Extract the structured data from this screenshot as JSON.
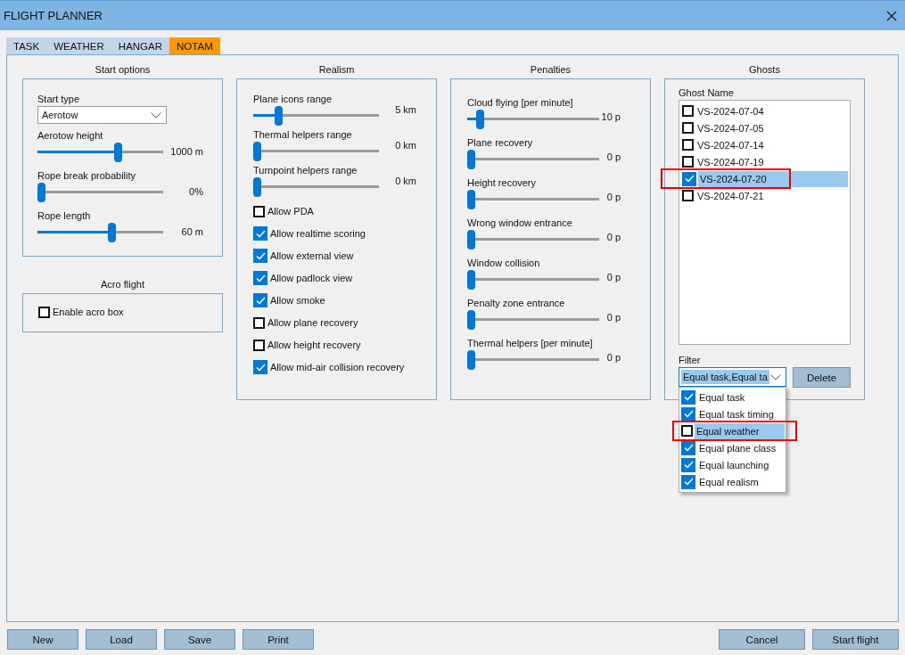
{
  "window": {
    "title": "FLIGHT PLANNER"
  },
  "tabs": [
    {
      "label": "TASK",
      "selected": false
    },
    {
      "label": "WEATHER",
      "selected": false
    },
    {
      "label": "HANGAR",
      "selected": false
    },
    {
      "label": "NOTAM",
      "selected": true
    }
  ],
  "start_options": {
    "title": "Start options",
    "start_type": {
      "label": "Start type",
      "value": "Aerotow"
    },
    "sliders": [
      {
        "label": "Aerotow height",
        "level": 0.65,
        "reading": "1000 m"
      },
      {
        "label": "Rope break probability",
        "level": 0,
        "reading": "0%"
      },
      {
        "label": "Rope length",
        "level": 0.6,
        "reading": "60 m"
      }
    ]
  },
  "acro_flight": {
    "title": "Acro flight",
    "checkbox": {
      "label": "Enable acro box",
      "checked": false
    }
  },
  "realism": {
    "title": "Realism",
    "sliders": [
      {
        "label": "Plane icons range",
        "level": 0.18,
        "reading": "5 km"
      },
      {
        "label": "Thermal helpers range",
        "level": 0,
        "reading": "0 km"
      },
      {
        "label": "Turnpoint helpers range",
        "level": 0,
        "reading": "0 km"
      }
    ],
    "checkboxes": [
      {
        "label": "Allow PDA",
        "checked": false
      },
      {
        "label": "Allow realtime scoring",
        "checked": true
      },
      {
        "label": "Allow external view",
        "checked": true
      },
      {
        "label": "Allow padlock view",
        "checked": true
      },
      {
        "label": "Allow smoke",
        "checked": true
      },
      {
        "label": "Allow plane recovery",
        "checked": false
      },
      {
        "label": "Allow height recovery",
        "checked": false
      },
      {
        "label": "Allow mid-air collision recovery",
        "checked": true
      }
    ]
  },
  "penalties": {
    "title": "Penalties",
    "sliders": [
      {
        "label": "Cloud flying [per minute]",
        "level": 0.07,
        "reading": "10 p"
      },
      {
        "label": "Plane recovery",
        "level": 0,
        "reading": "0 p"
      },
      {
        "label": "Height recovery",
        "level": 0,
        "reading": "0 p"
      },
      {
        "label": "Wrong window entrance",
        "level": 0,
        "reading": "0 p"
      },
      {
        "label": "Window collision",
        "level": 0,
        "reading": "0 p"
      },
      {
        "label": "Penalty zone entrance",
        "level": 0,
        "reading": "0 p"
      },
      {
        "label": "Thermal helpers [per minute]",
        "level": 0,
        "reading": "0 p"
      }
    ]
  },
  "ghosts": {
    "title": "Ghosts",
    "list_header": "Ghost Name",
    "items": [
      {
        "name": "VS-2024-07-04",
        "checked": false,
        "selected": false,
        "highlighted": false
      },
      {
        "name": "VS-2024-07-05",
        "checked": false,
        "selected": false,
        "highlighted": false
      },
      {
        "name": "VS-2024-07-14",
        "checked": false,
        "selected": false,
        "highlighted": false
      },
      {
        "name": "VS-2024-07-19",
        "checked": false,
        "selected": false,
        "highlighted": false
      },
      {
        "name": "VS-2024-07-20",
        "checked": true,
        "selected": true,
        "highlighted": true
      },
      {
        "name": "VS-2024-07-21",
        "checked": false,
        "selected": false,
        "highlighted": false
      }
    ],
    "filter": {
      "label": "Filter",
      "value": "Equal task,Equal ta",
      "expanded": true,
      "options": [
        {
          "label": "Equal task",
          "checked": true,
          "selected": false,
          "highlighted": false
        },
        {
          "label": "Equal task timing",
          "checked": true,
          "selected": false,
          "highlighted": false
        },
        {
          "label": "Equal weather",
          "checked": false,
          "selected": true,
          "highlighted": true
        },
        {
          "label": "Equal plane class",
          "checked": true,
          "selected": false,
          "highlighted": false
        },
        {
          "label": "Equal launching",
          "checked": true,
          "selected": false,
          "highlighted": false
        },
        {
          "label": "Equal realism",
          "checked": true,
          "selected": false,
          "highlighted": false
        }
      ]
    },
    "delete_button": "Delete"
  },
  "buttons_left": [
    "New",
    "Load",
    "Save",
    "Print"
  ],
  "buttons_right": [
    "Cancel",
    "Start flight"
  ]
}
